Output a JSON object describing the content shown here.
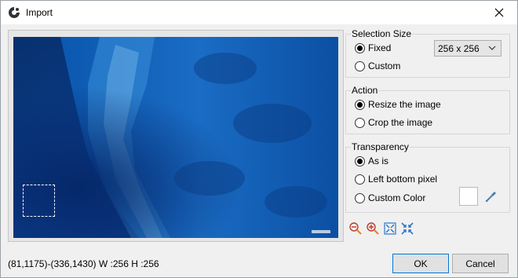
{
  "window": {
    "title": "Import"
  },
  "selection_size": {
    "legend": "Selection Size",
    "options": [
      {
        "label": "Fixed",
        "checked": true
      },
      {
        "label": "Custom",
        "checked": false
      }
    ],
    "dropdown_value": "256 x 256"
  },
  "action": {
    "legend": "Action",
    "options": [
      {
        "label": "Resize the image",
        "checked": true
      },
      {
        "label": "Crop the image",
        "checked": false
      }
    ]
  },
  "transparency": {
    "legend": "Transparency",
    "options": [
      {
        "label": "As is",
        "checked": true
      },
      {
        "label": "Left bottom pixel",
        "checked": false
      },
      {
        "label": "Custom Color",
        "checked": false
      }
    ],
    "swatch_color": "#ffffff"
  },
  "status": {
    "text": "(81,1175)-(336,1430) W :256 H :256"
  },
  "buttons": {
    "ok": "OK",
    "cancel": "Cancel"
  },
  "icons": {
    "app": "app-logo-icon",
    "close": "close-icon",
    "zoom_out": "zoom-out-icon",
    "zoom_in": "zoom-in-icon",
    "fit": "fit-to-window-icon",
    "actual": "actual-size-icon",
    "picker": "color-picker-icon"
  }
}
